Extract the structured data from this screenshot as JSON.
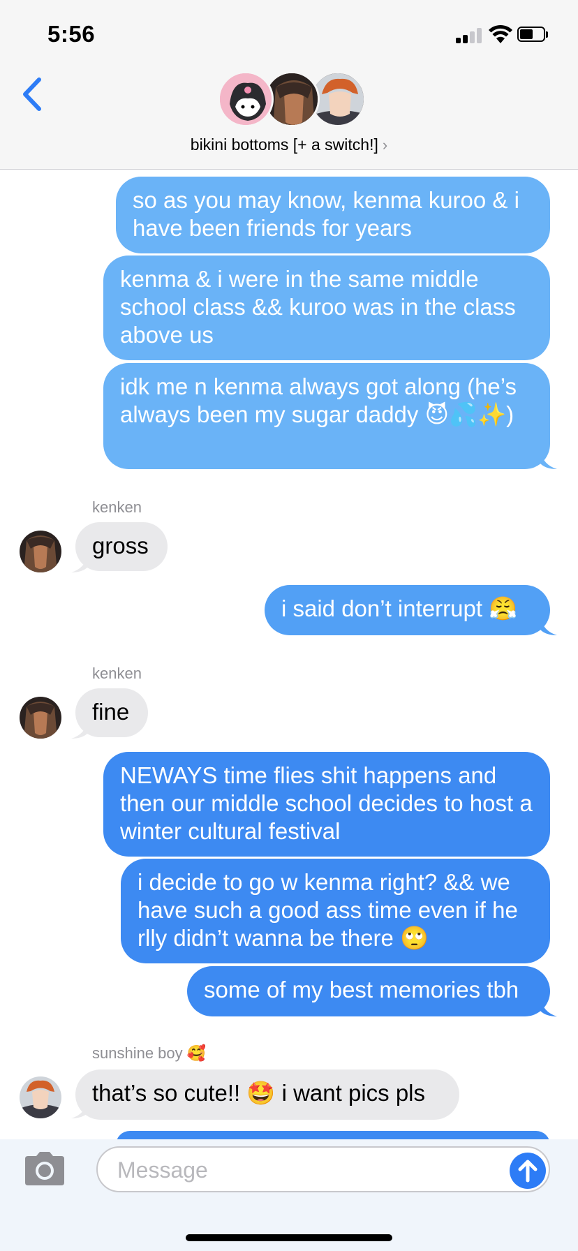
{
  "status": {
    "time": "5:56"
  },
  "header": {
    "group_name": "bikini bottoms [+ a switch!]",
    "chevron": "›"
  },
  "messages": [
    {
      "type": "out",
      "text": "so as you may know, kenma kuroo & i have been friends for years"
    },
    {
      "type": "out",
      "text": "kenma & i were in the same middle school class && kuroo was in the class above us"
    },
    {
      "type": "out",
      "text": "idk me n kenma always got along (he’s always been my sugar daddy 😈💦✨)"
    },
    {
      "type": "in",
      "sender": "kenken",
      "text": "gross"
    },
    {
      "type": "out",
      "text": "i said don’t interrupt 😤"
    },
    {
      "type": "in",
      "sender": "kenken",
      "text": "fine"
    },
    {
      "type": "out",
      "text": "NEWAYS time flies shit happens and then our middle school decides to host a winter cultural festival"
    },
    {
      "type": "out",
      "text": "i decide to go w kenma right? && we have such a good ass time even if he rlly didn’t wanna be there 🙄"
    },
    {
      "type": "out",
      "text": "some of my best memories tbh"
    },
    {
      "type": "in",
      "sender": "sunshine boy 🥰",
      "text": "that’s so cute!! 🤩 i want pics pls"
    }
  ],
  "composer": {
    "placeholder": "Message"
  },
  "icons": {
    "back": "chevron-left-icon",
    "camera": "camera-icon",
    "send": "arrow-up-icon",
    "signal": "signal-icon",
    "wifi": "wifi-icon",
    "battery": "battery-icon"
  },
  "colors": {
    "outgoing": "#3d8af2",
    "incoming": "#e9e9eb",
    "accent": "#2d7cf6"
  }
}
